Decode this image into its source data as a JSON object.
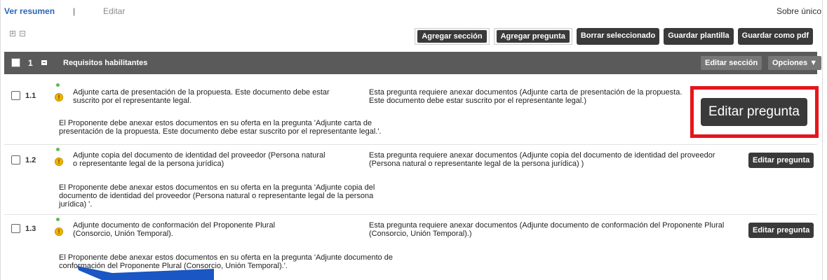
{
  "header": {
    "view_summary": "Ver resumen",
    "separator": "|",
    "edit": "Editar",
    "envelope": "Sobre único"
  },
  "toolbar": {
    "add_section": "Agregar sección",
    "add_question": "Agregar pregunta",
    "delete_selected": "Borrar seleccionado",
    "save_template": "Guardar plantilla",
    "save_pdf": "Guardar como pdf"
  },
  "section": {
    "number": "1",
    "title": "Requisitos habilitantes",
    "edit_section": "Editar sección",
    "options": "Opciones"
  },
  "questions": [
    {
      "number": "1.1",
      "text": "Adjunte carta de presentación de la propuesta. Este documento debe estar suscrito por el representante legal.",
      "description": "Esta pregunta requiere anexar documentos (Adjunte carta de presentación de la propuesta. Este documento debe estar suscrito por el representante legal.)",
      "note": "El Proponente debe anexar estos documentos en su oferta en la pregunta 'Adjunte carta de presentación de la propuesta. Este documento debe estar suscrito por el representante legal.'.",
      "edit_label": "Editar pregunta"
    },
    {
      "number": "1.2",
      "text": "Adjunte copia del documento de identidad del proveedor (Persona natural o representante legal de la persona jurídica)",
      "description": "Esta pregunta requiere anexar documentos (Adjunte copia del documento de identidad del proveedor (Persona natural o representante legal de la persona jurídica) )",
      "note": "El Proponente debe anexar estos documentos en su oferta en la pregunta 'Adjunte copia del documento de identidad del proveedor (Persona natural o representante legal de la persona jurídica) '.",
      "edit_label": "Editar pregunta"
    },
    {
      "number": "1.3",
      "text": "Adjunte documento de conformación del Proponente Plural (Consorcio, Unión Temporal).",
      "description": "Esta pregunta requiere anexar documentos (Adjunte documento de conformación del Proponente Plural (Consorcio, Unión Temporal).)",
      "note": "El Proponente debe anexar estos documentos en su oferta en la pregunta 'Adjunte documento de conformación del Proponente Plural (Consorcio, Unión Temporal).'.",
      "edit_label": "Editar pregunta"
    }
  ],
  "callout": {
    "label": "Editar pregunta",
    "border_color": "#e6151c",
    "arrow_color": "#1a56c4"
  }
}
